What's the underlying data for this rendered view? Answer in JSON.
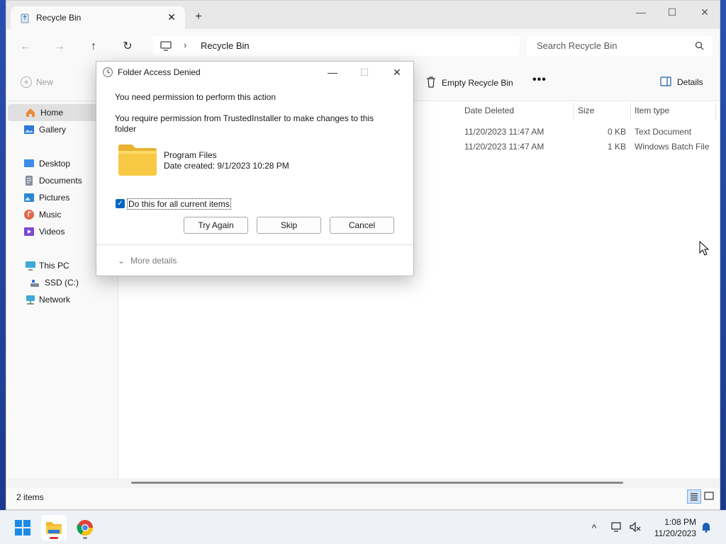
{
  "window": {
    "tab_title": "Recycle Bin",
    "tab_close": "✕",
    "tab_new": "+",
    "min": "—",
    "max": "☐",
    "close": "✕"
  },
  "nav": {
    "back": "←",
    "forward": "→",
    "up": "↑",
    "refresh": "↻",
    "chevron": "›",
    "address": "Recycle Bin",
    "search_placeholder": "Search Recycle Bin"
  },
  "toolbar": {
    "new_label": "New",
    "empty_label": "Empty Recycle Bin",
    "more_label": "•••",
    "details_label": "Details"
  },
  "sidebar": {
    "items": [
      {
        "label": "Home"
      },
      {
        "label": "Gallery"
      },
      {
        "label": "Desktop"
      },
      {
        "label": "Documents"
      },
      {
        "label": "Pictures"
      },
      {
        "label": "Music"
      },
      {
        "label": "Videos"
      },
      {
        "label": "This PC"
      },
      {
        "label": "SSD (C:)"
      },
      {
        "label": "Network"
      }
    ]
  },
  "list": {
    "columns": [
      "Date Deleted",
      "Size",
      "Item type"
    ],
    "rows": [
      {
        "date": "11/20/2023 11:47 AM",
        "size": "0 KB",
        "type": "Text Document"
      },
      {
        "date": "11/20/2023 11:47 AM",
        "size": "1 KB",
        "type": "Windows Batch File"
      }
    ]
  },
  "status": {
    "count": "2 items"
  },
  "dialog": {
    "title": "Folder Access Denied",
    "min": "—",
    "max": "☐",
    "close": "✕",
    "message1": "You need permission to perform this action",
    "message2": "You require permission from TrustedInstaller to make changes to this folder",
    "item_name": "Program Files",
    "item_date": "Date created: 9/1/2023 10:28 PM",
    "checkbox_label": "Do this for all current items",
    "checkbox_mark": "✓",
    "buttons": {
      "try_again": "Try Again",
      "skip": "Skip",
      "cancel": "Cancel"
    },
    "more_details": "More details",
    "more_chevron": "⌄"
  },
  "taskbar": {
    "time": "1:08 PM",
    "date": "11/20/2023",
    "tray_chevron": "^"
  },
  "colors": {
    "accent": "#0067c0",
    "folder": "#f8c945"
  }
}
